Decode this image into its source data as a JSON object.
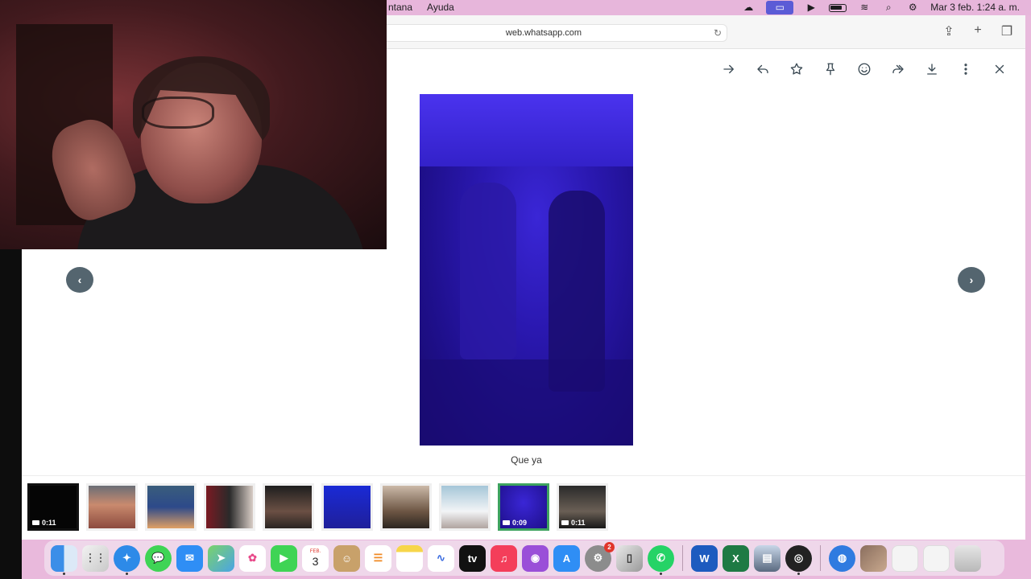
{
  "menubar": {
    "items": [
      "ntana",
      "Ayuda"
    ],
    "clock": "Mar 3 feb.  1:24 a. m."
  },
  "browser": {
    "url": "web.whatsapp.com"
  },
  "viewer": {
    "actions": [
      "arrow-right-icon",
      "reply-icon",
      "star-icon",
      "pin-icon",
      "emoji-icon",
      "forward-icon",
      "download-icon",
      "more-icon",
      "close-icon"
    ],
    "caption": "Que ya",
    "prev_icon": "‹",
    "next_icon": "›"
  },
  "thumbnails": [
    {
      "name": "thumb-video-1",
      "duration": "0:11",
      "video": true
    },
    {
      "name": "thumb-photo-1",
      "duration": "",
      "video": false
    },
    {
      "name": "thumb-photo-2",
      "duration": "",
      "video": false
    },
    {
      "name": "thumb-photo-3",
      "duration": "",
      "video": false
    },
    {
      "name": "thumb-photo-4",
      "duration": "",
      "video": false
    },
    {
      "name": "thumb-photo-5",
      "duration": "",
      "video": false
    },
    {
      "name": "thumb-photo-6",
      "duration": "",
      "video": false
    },
    {
      "name": "thumb-photo-7",
      "duration": "",
      "video": false
    },
    {
      "name": "thumb-video-2",
      "duration": "0:09",
      "video": true,
      "active": true
    },
    {
      "name": "thumb-video-3",
      "duration": "0:11",
      "video": true
    }
  ],
  "dock": {
    "calendar_month": "FEB.",
    "calendar_day": "3",
    "settings_badge": "2",
    "word_label": "W",
    "excel_label": "X"
  },
  "colors": {
    "menubar_bg": "#e7b6db",
    "whatsapp_icon_gray": "#3b4a54",
    "active_thumb_border": "#3ea35f",
    "nav_button_bg": "#54656f"
  }
}
